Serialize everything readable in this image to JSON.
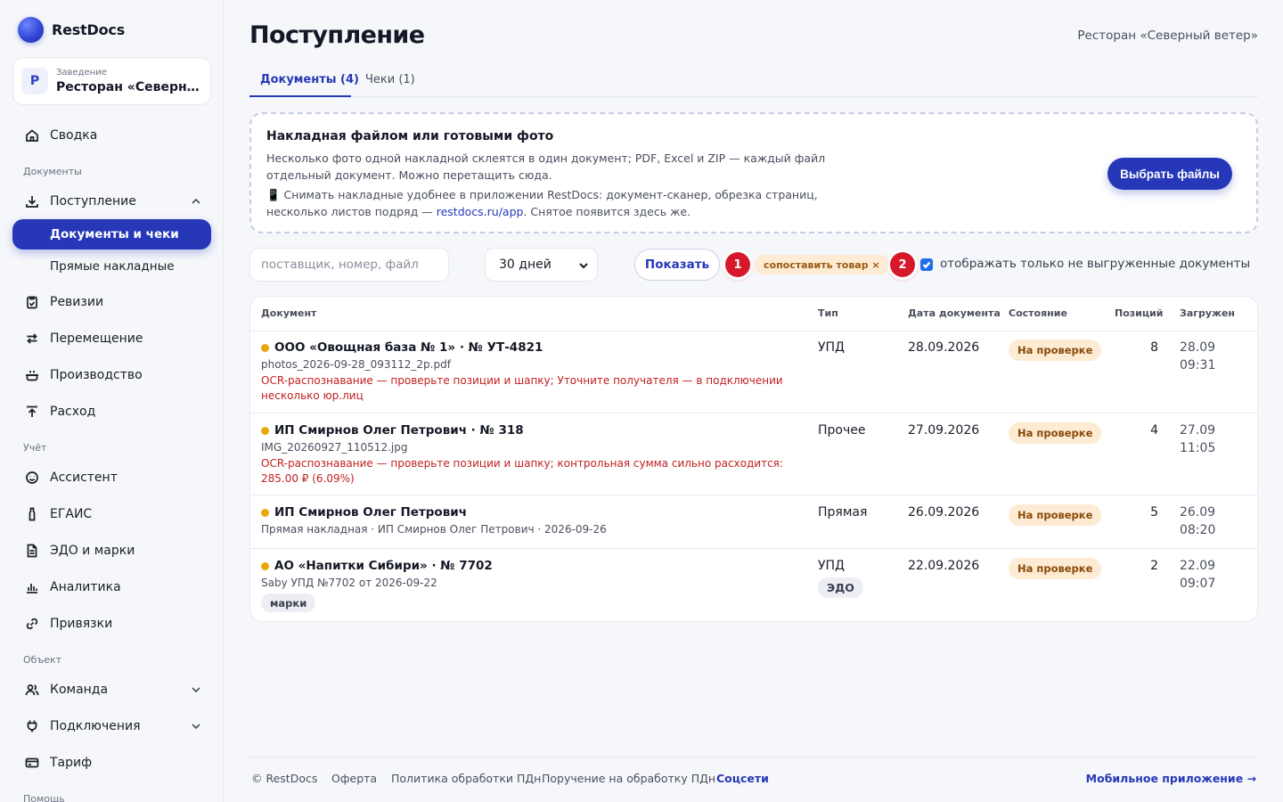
{
  "brand": {
    "name": "RestDocs"
  },
  "venue": {
    "label": "Заведение",
    "avatar": "Р",
    "name": "Ресторан «Северный ветер»"
  },
  "nav": {
    "summary": "Сводка",
    "section_docs": "Документы",
    "receipts": "Поступление",
    "sub_docs": "Документы и чеки",
    "sub_direct": "Прямые накладные",
    "audits": "Ревизии",
    "transfer": "Перемещение",
    "production": "Производство",
    "expense": "Расход",
    "section_account": "Учёт",
    "assistant": "Ассистент",
    "egais": "ЕГАИС",
    "edo": "ЭДО и марки",
    "analytics": "Аналитика",
    "links": "Привязки",
    "section_object": "Объект",
    "team": "Команда",
    "connections": "Подключения",
    "tariff": "Тариф",
    "section_help": "Помощь"
  },
  "header": {
    "title": "Поступление",
    "venue": "Ресторан «Северный ветер»"
  },
  "tabs": [
    {
      "label": "Документы (4)"
    },
    {
      "label": "Чеки (1)"
    }
  ],
  "upload": {
    "title": "Накладная файлом или готовыми фото",
    "text": "Несколько фото одной накладной склеятся в один документ; PDF, Excel и ZIP — каждый файл отдельный документ. Можно перетащить сюда.",
    "text2_prefix": "📱 Снимать накладные удобнее в приложении RestDocs: документ-сканер, обрезка страниц, несколько листов подряд — ",
    "text2_link": "restdocs.ru/app",
    "text2_suffix": ". Снятое появится здесь же.",
    "button": "Выбрать файлы"
  },
  "filters": {
    "search_placeholder": "поставщик, номер, файл",
    "period": "30 дней",
    "show": "Показать",
    "step1": "1",
    "tag": "сопоставить товар ×",
    "step2": "2",
    "only_not_exported": "отображать только не выгруженные документы"
  },
  "table": {
    "headers": {
      "doc": "Документ",
      "type": "Тип",
      "date": "Дата документа",
      "state": "Состояние",
      "positions": "Позиций",
      "loaded": "Загружен"
    },
    "rows": [
      {
        "title": "ООО «Овощная база № 1» · № УТ-4821",
        "file": "photos_2026-09-28_093112_2p.pdf",
        "warn": "OCR-распознавание — проверьте позиции и шапку; Уточните получателя — в подключении несколько юр.лиц",
        "type": "УПД",
        "date": "28.09.2026",
        "state": "На проверке",
        "positions": "8",
        "loaded": "28.09 09:31"
      },
      {
        "title": "ИП Смирнов Олег Петрович · № 318",
        "file": "IMG_20260927_110512.jpg",
        "warn": "OCR-распознавание — проверьте позиции и шапку; контрольная сумма сильно расходится: 285.00 ₽ (6.09%)",
        "type": "Прочее",
        "date": "27.09.2026",
        "state": "На проверке",
        "positions": "4",
        "loaded": "27.09 11:05"
      },
      {
        "title": "ИП Смирнов Олег Петрович",
        "file": "Прямая накладная · ИП Смирнов Олег Петрович · 2026-09-26",
        "type": "Прямая",
        "date": "26.09.2026",
        "state": "На проверке",
        "positions": "5",
        "loaded": "26.09 08:20"
      },
      {
        "title": "АО «Напитки Сибири» · № 7702",
        "file": "Saby УПД №7702 от 2026-09-22",
        "pill": "марки",
        "type": "УПД",
        "type_pill": "ЭДО",
        "date": "22.09.2026",
        "state": "На проверке",
        "positions": "2",
        "loaded": "22.09 09:07"
      }
    ]
  },
  "footer": {
    "copyright": "© RestDocs",
    "offer": "Оферта",
    "policy": "Политика обработки ПДн",
    "consent": "Поручение на обработку ПДн",
    "social": "Соцсети",
    "mobile": "Мобильное приложение →"
  },
  "colors": {
    "accent": "#2638b8",
    "warning": "#c21f1f",
    "badge": "#fdebd3",
    "step": "#d7182a"
  }
}
